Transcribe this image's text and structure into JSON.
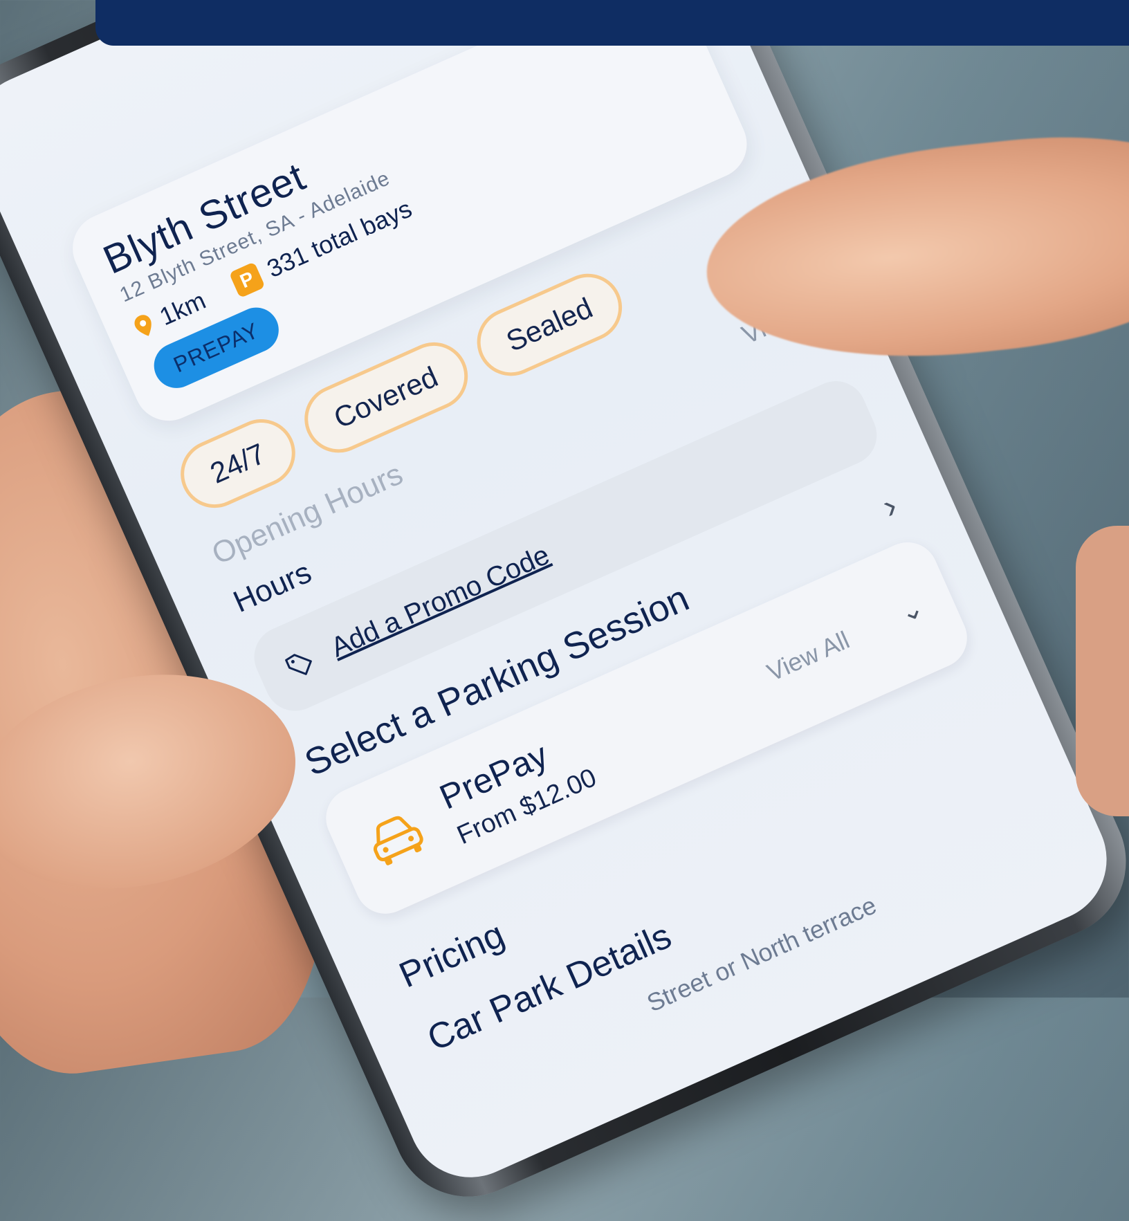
{
  "carpark": {
    "name": "Blyth Street",
    "address": "12 Blyth Street, SA - Adelaide",
    "distance": "1km",
    "total_bays": "331 total bays",
    "badge": "PREPAY"
  },
  "features": [
    "24/7",
    "Covered",
    "Sealed"
  ],
  "view_link": "View",
  "opening_hours": {
    "label": "Opening Hours",
    "value": "Hours"
  },
  "promo": {
    "label": "Add a Promo Code"
  },
  "parking_session": {
    "title": "Select a Parking Session",
    "option": {
      "name": "PrePay",
      "price": "From $12.00",
      "view_all": "View All"
    }
  },
  "sections": {
    "pricing": "Pricing",
    "car_park_details": "Car Park Details",
    "details_text": "Street or North terrace"
  },
  "colors": {
    "top_bar": "#0f2d63",
    "accent_orange": "#f5a21a",
    "prepay_blue": "#1d8fe4",
    "text_dark": "#0f2350"
  },
  "icons": [
    "pin-icon",
    "parking-icon",
    "tag-icon",
    "car-icon",
    "chevron-right-icon",
    "chevron-down-icon"
  ]
}
